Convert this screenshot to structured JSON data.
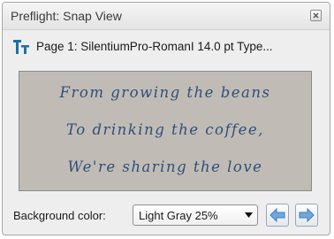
{
  "window": {
    "title": "Preflight: Snap View"
  },
  "info": {
    "icon": "type-icon",
    "text": "Page 1: SilentiumPro-RomanI 14.0 pt Type..."
  },
  "preview": {
    "lines": [
      "From growing the beans",
      "To drinking the coffee,",
      "We're sharing the love"
    ]
  },
  "controls": {
    "background_label": "Background color:",
    "background_value": "Light Gray 25%",
    "prev_icon": "arrow-left-icon",
    "next_icon": "arrow-right-icon"
  },
  "colors": {
    "preview_background": "#c0bcb5",
    "preview_text": "#2f4f7a",
    "arrow_fill": "#6fa8dc"
  }
}
